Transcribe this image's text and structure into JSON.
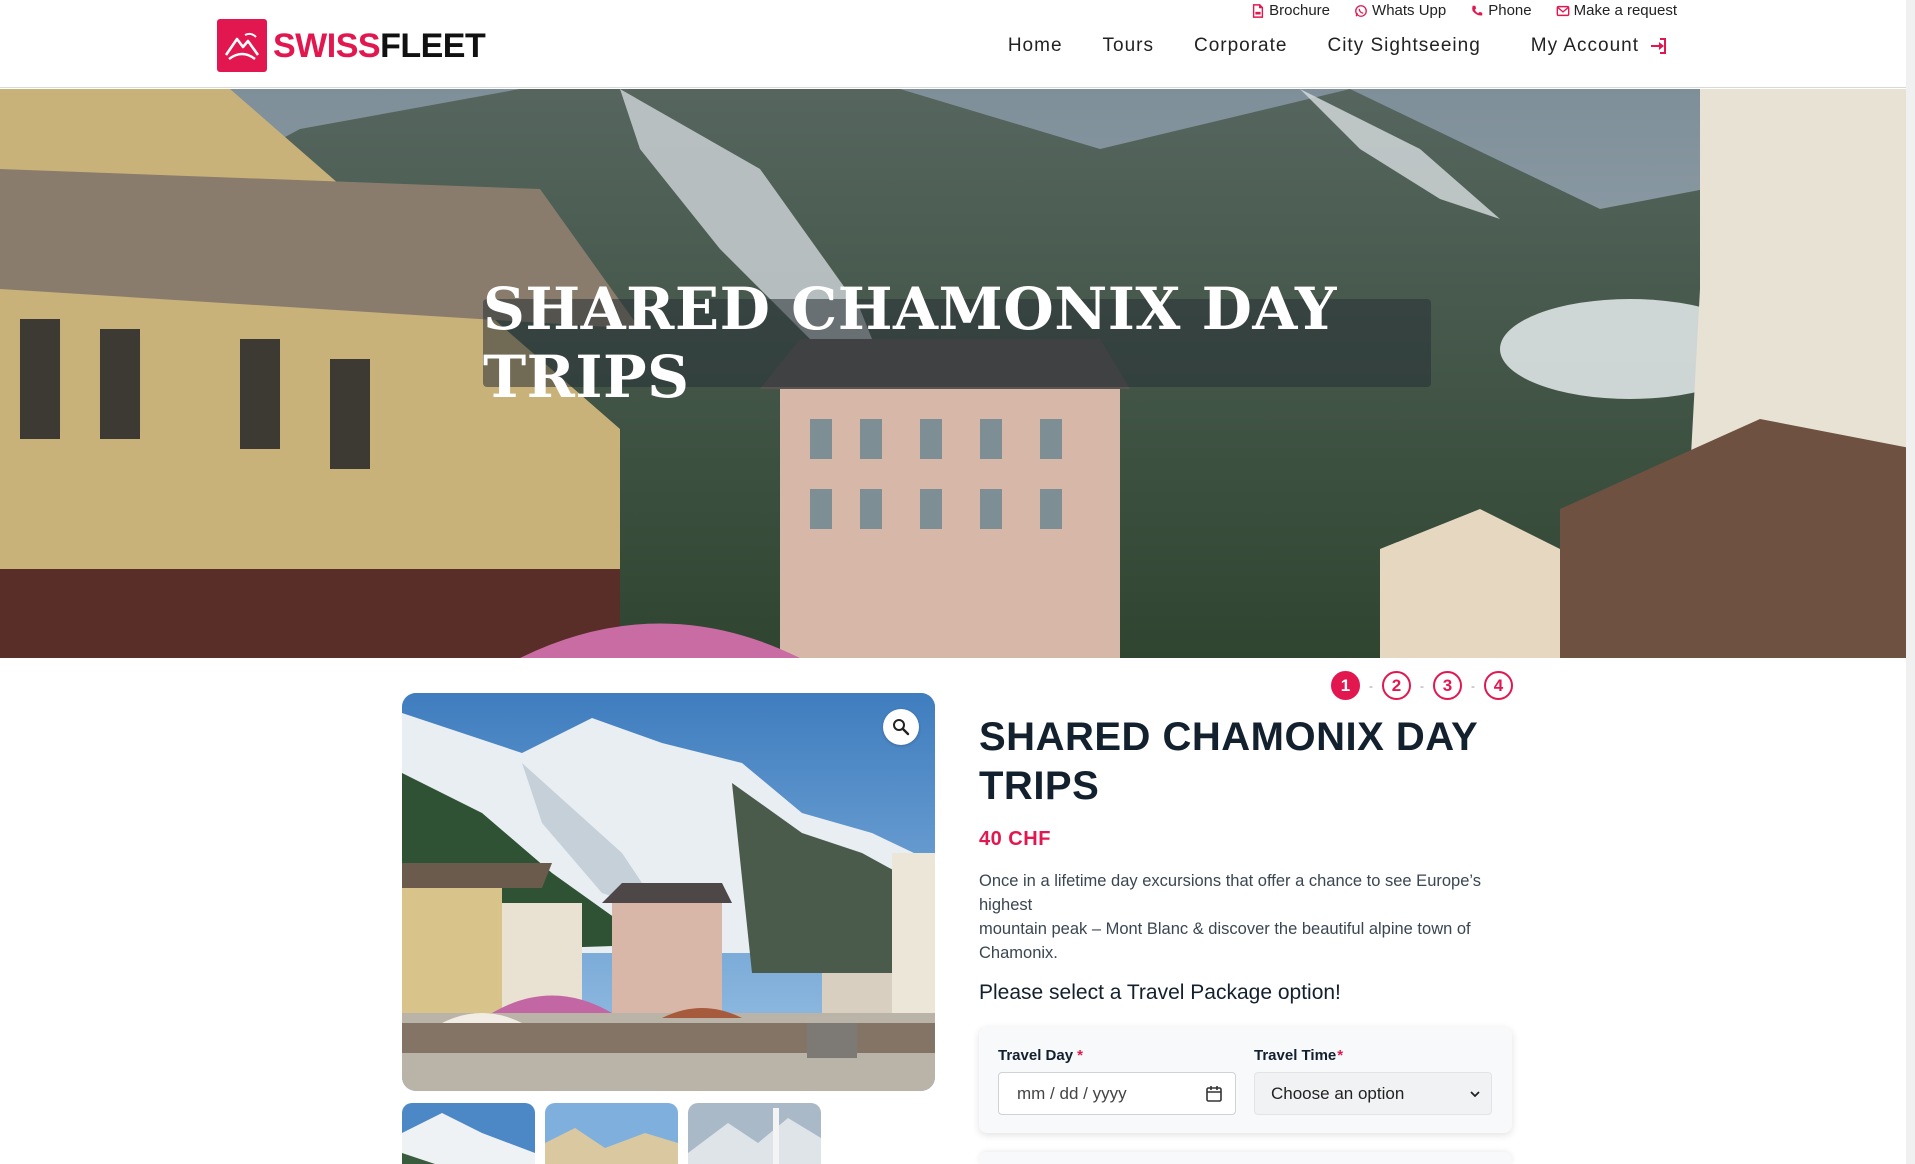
{
  "brand": {
    "name_part1": "SWISS",
    "name_part2": "FLEET",
    "accent_color": "#e3174f"
  },
  "top_links": [
    {
      "label": "Brochure",
      "icon": "pdf-file-icon"
    },
    {
      "label": "Whats Upp",
      "icon": "whatsapp-icon"
    },
    {
      "label": "Phone",
      "icon": "phone-icon"
    },
    {
      "label": "Make a request",
      "icon": "envelope-icon"
    }
  ],
  "nav": {
    "items": [
      "Home",
      "Tours",
      "Corporate",
      "City Sightseeing"
    ],
    "account_label": "My Account",
    "account_icon": "sign-in-icon"
  },
  "hero": {
    "title": "SHARED CHAMONIX DAY TRIPS"
  },
  "steps": [
    "1",
    "2",
    "3",
    "4"
  ],
  "product": {
    "title": "SHARED CHAMONIX DAY TRIPS",
    "price": "40 CHF",
    "description_line1": "Once in a lifetime day excursions that offer a chance to see Europe’s highest",
    "description_line2": "mountain peak – Mont Blanc & discover the beautiful alpine town of Chamonix.",
    "select_prompt": "Please select a Travel Package option!"
  },
  "form": {
    "travel_day_label": "Travel Day",
    "travel_day_placeholder": "mm / dd / yyyy",
    "travel_time_label": "Travel Time",
    "travel_time_value": "Choose an option",
    "required_mark": "*"
  }
}
